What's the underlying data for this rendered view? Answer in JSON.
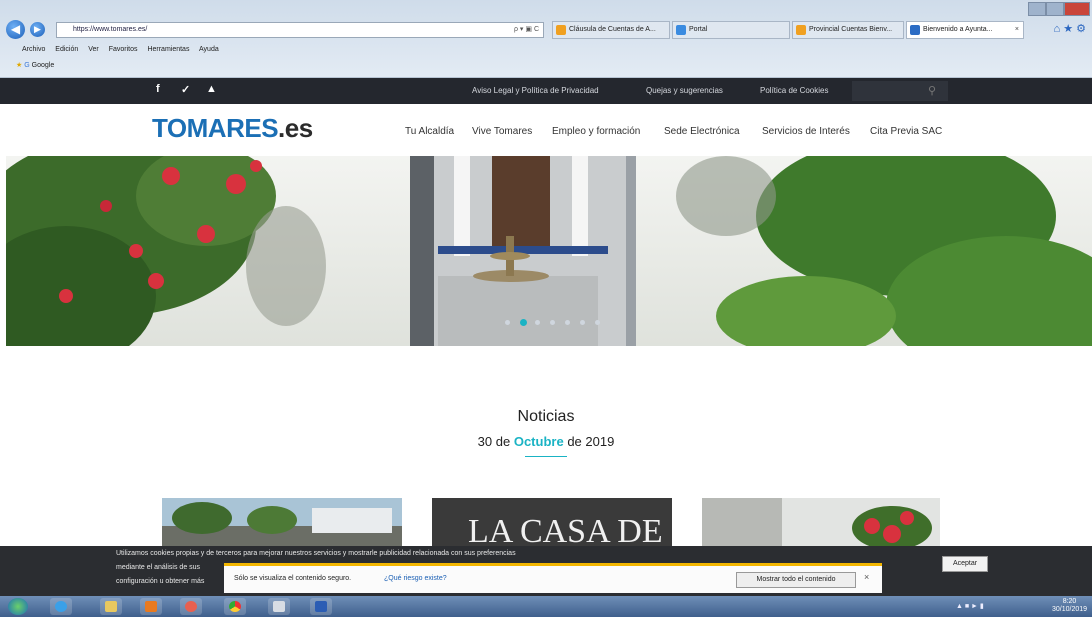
{
  "browser": {
    "address": "https://www.tomares.es/",
    "address_ctrl": "ρ ▾ ▣ C",
    "tabs": [
      {
        "label": "Cláusula de Cuentas de A..."
      },
      {
        "label": "Portal"
      },
      {
        "label": "Provincial Cuentas Bienv..."
      },
      {
        "label": "Bienvenido a Ayunta..."
      }
    ],
    "menu": [
      "Archivo",
      "Edición",
      "Ver",
      "Favoritos",
      "Herramientas",
      "Ayuda"
    ],
    "favorites": [
      "Google"
    ]
  },
  "site": {
    "social": [
      "f",
      "✓",
      "▲"
    ],
    "top_links": [
      "Aviso Legal y Política de Privacidad",
      "Quejas y sugerencias",
      "Política de Cookies"
    ],
    "logo_main": "TOMARES",
    "logo_suffix": ".es",
    "nav": [
      "Tu Alcaldía",
      "Vive Tomares",
      "Empleo y formación",
      "Sede Electrónica",
      "Servicios de Interés",
      "Cita Previa SAC"
    ],
    "slider": {
      "dots": 7,
      "active": 1
    }
  },
  "news": {
    "title": "Noticias",
    "date_pre": "30 de",
    "date_month": "Octubre",
    "date_post": "de 2019",
    "card2_text": "LA CASA DE"
  },
  "cookie": {
    "line1": "Utilizamos cookies propias y de terceros para mejorar nuestros servicios y mostrarle publicidad relacionada con sus preferencias",
    "line2": "mediante el análisis de sus",
    "line3": "configuración u obtener más",
    "accept": "Aceptar"
  },
  "notification": {
    "message": "Sólo se visualiza el contenido seguro.",
    "why": "¿Qué riesgo existe?",
    "show_all": "Mostrar todo el contenido",
    "close": "×"
  },
  "taskbar": {
    "clock_time": "8:20",
    "clock_date": "30/10/2019"
  }
}
